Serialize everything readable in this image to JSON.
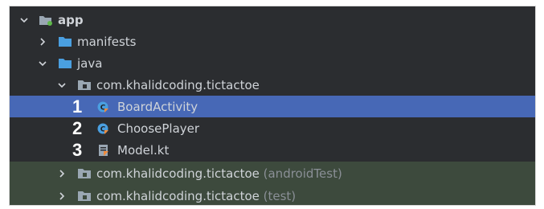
{
  "tree": {
    "app": {
      "label": "app"
    },
    "manifests": {
      "label": "manifests"
    },
    "java": {
      "label": "java"
    },
    "package_main": {
      "label": "com.khalidcoding.tictactoe"
    },
    "files": [
      {
        "number": "1",
        "label": "BoardActivity"
      },
      {
        "number": "2",
        "label": "ChoosePlayer"
      },
      {
        "number": "3",
        "label": "Model.kt"
      }
    ],
    "package_android_test": {
      "label": "com.khalidcoding.tictactoe",
      "suffix": "(androidTest)"
    },
    "package_test": {
      "label": "com.khalidcoding.tictactoe",
      "suffix": "(test)"
    }
  },
  "colors": {
    "panel_bg": "#2b2d30",
    "selected_bg": "#4768b6",
    "test_bg": "#3d4a3d",
    "folder_blue": "#4a9fe0",
    "text": "#cfd3d8",
    "dim_text": "#8a8f96"
  }
}
